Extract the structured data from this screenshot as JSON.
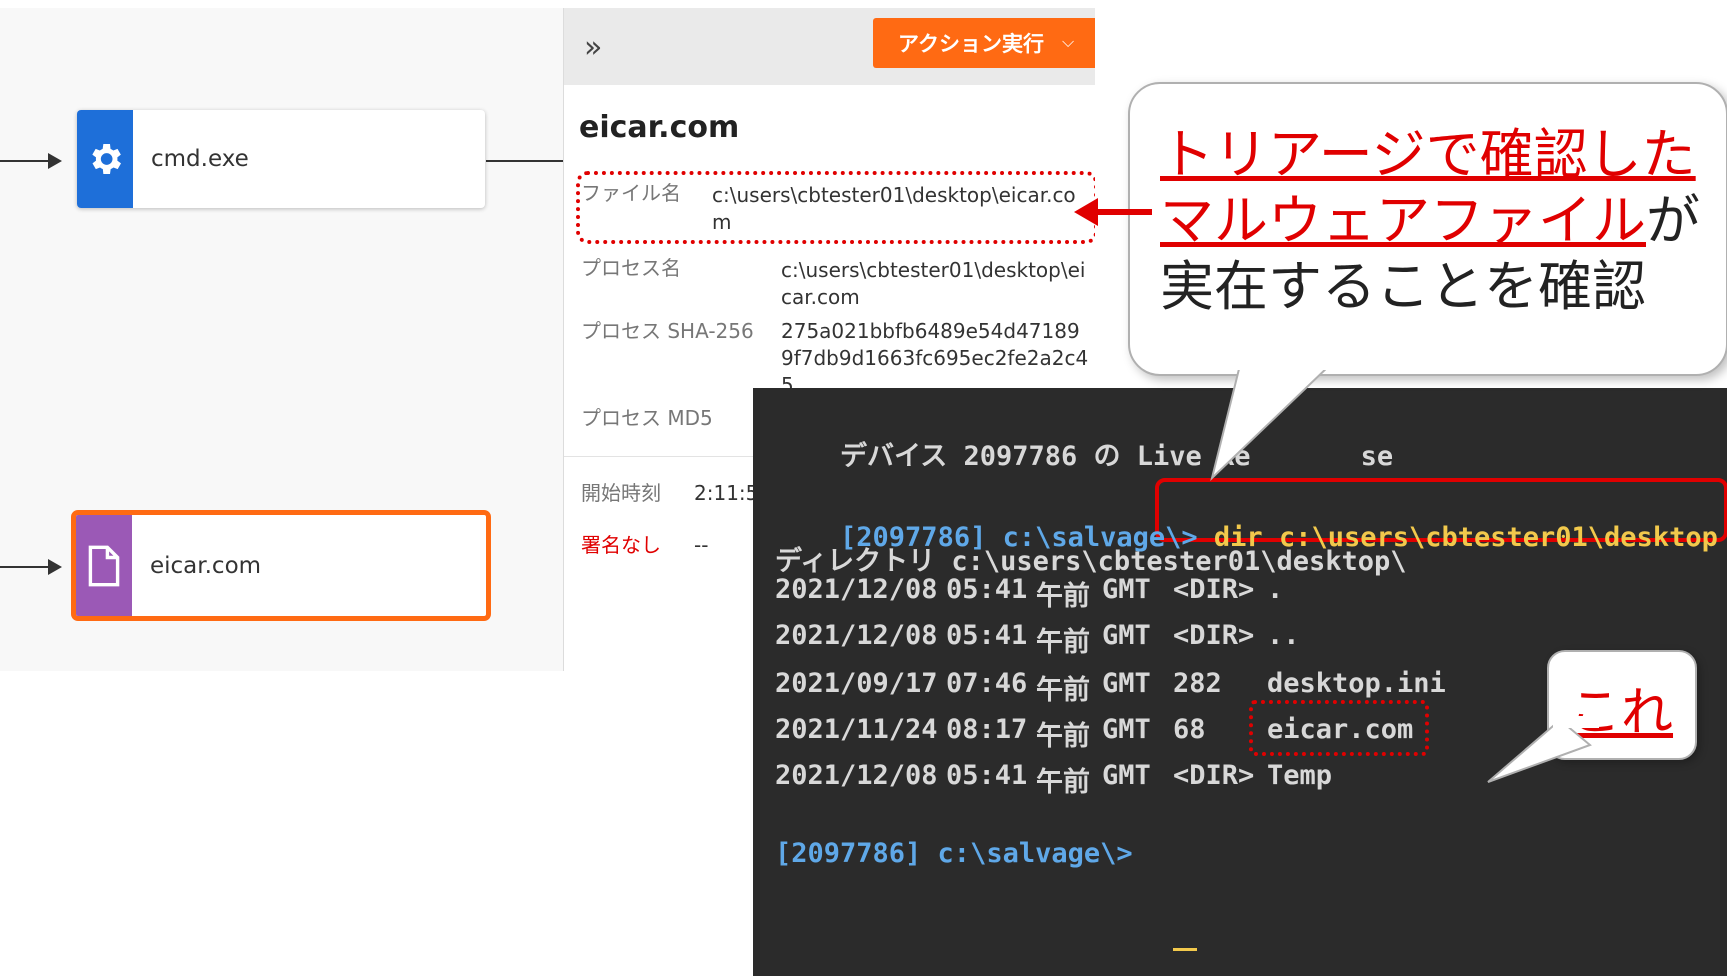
{
  "process_tree": {
    "nodes": [
      {
        "label": "cmd.exe",
        "icon": "gear-icon",
        "color": "#1e6fd9"
      },
      {
        "label": "eicar.com",
        "icon": "file-icon",
        "color": "#9b59b6"
      }
    ]
  },
  "details": {
    "action_button": "アクション実行",
    "title": "eicar.com",
    "rows": [
      {
        "key": "ファイル名",
        "value": "c:\\users\\cbtester01\\desktop\\eicar.com"
      },
      {
        "key": "プロセス名",
        "value": "c:\\users\\cbtester01\\desktop\\eicar.com"
      },
      {
        "key": "プロセス SHA-256",
        "value": "275a021bbfb6489e54d471899f7db9d1663fc695ec2fe2a2c45"
      },
      {
        "key": "プロセス MD5",
        "value": ""
      },
      {
        "key": "開始時刻",
        "value": "2:11:5"
      },
      {
        "key": "署名なし",
        "value": "--"
      }
    ]
  },
  "terminal": {
    "header": "デバイス 2097786 の Live Re",
    "header_tail": "se",
    "prompt": "[2097786] c:\\salvage\\>",
    "command": "dir c:\\users\\cbtester01\\desktop",
    "dir_line": "ディレクトリ c:\\users\\cbtester01\\desktop\\",
    "entries": [
      {
        "date": "2021/12/08",
        "time": "05:41",
        "ampm": "午前",
        "tz": "GMT",
        "size": "<DIR>",
        "name": "."
      },
      {
        "date": "2021/12/08",
        "time": "05:41",
        "ampm": "午前",
        "tz": "GMT",
        "size": "<DIR>",
        "name": ".."
      },
      {
        "date": "2021/09/17",
        "time": "07:46",
        "ampm": "午前",
        "tz": "GMT",
        "size": "282",
        "name": "desktop.ini"
      },
      {
        "date": "2021/11/24",
        "time": "08:17",
        "ampm": "午前",
        "tz": "GMT",
        "size": "68",
        "name": "eicar.com"
      },
      {
        "date": "2021/12/08",
        "time": "05:41",
        "ampm": "午前",
        "tz": "GMT",
        "size": "<DIR>",
        "name": "Temp"
      }
    ],
    "final_prompt": "[2097786] c:\\salvage\\>"
  },
  "callouts": {
    "main_red_1": "トリアージで確認した",
    "main_red_2": "マルウェアファイル",
    "main_tail_2": "が",
    "main_line_3": "実在することを確認",
    "small": "これ"
  },
  "colors": {
    "accent_orange": "#ff6a13",
    "annotation_red": "#e00000",
    "prompt_blue": "#5fa8e8",
    "command_yellow": "#f2c94c"
  }
}
